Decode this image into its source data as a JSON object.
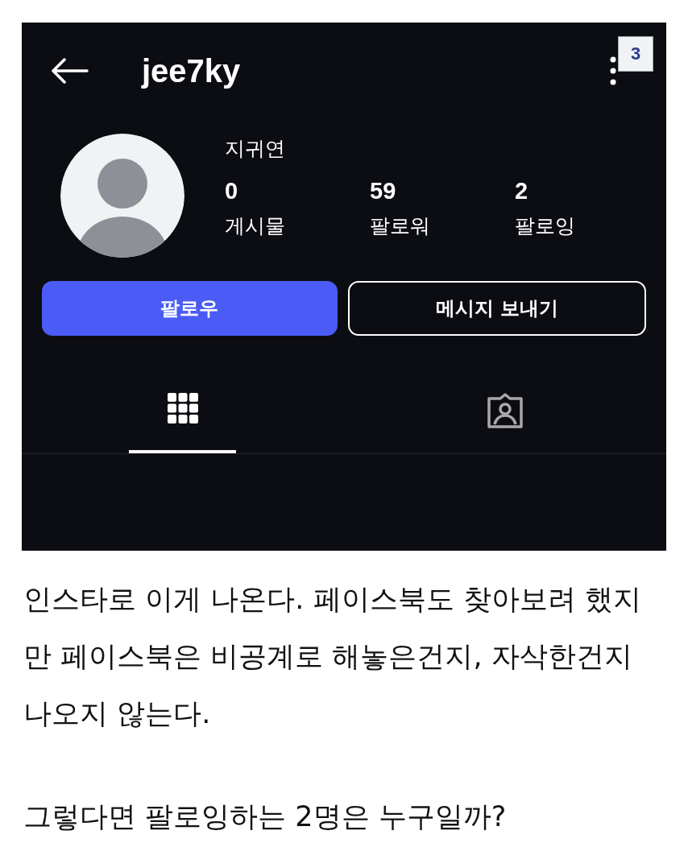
{
  "profile_screenshot": {
    "username": "jee7ky",
    "badge": "3",
    "name": "지귀연",
    "stats": [
      {
        "value": "0",
        "label": "게시물"
      },
      {
        "value": "59",
        "label": "팔로워"
      },
      {
        "value": "2",
        "label": "팔로잉"
      }
    ],
    "buttons": [
      {
        "kind": "primary",
        "label": "팔로우"
      },
      {
        "kind": "secondary",
        "label": "메시지 보내기"
      }
    ],
    "tabs": [
      {
        "kind": "grid",
        "selected": true
      },
      {
        "kind": "tagged",
        "selected": false
      }
    ]
  },
  "paragraphs": [
    "인스타로 이게 나온다. 페이스북도 찾아보려 했지만 페이스북은 비공계로 해놓은건지, 자삭한건지 나오지 않는다.",
    "그렇다면 팔로잉하는 2명은 누구일까?"
  ]
}
